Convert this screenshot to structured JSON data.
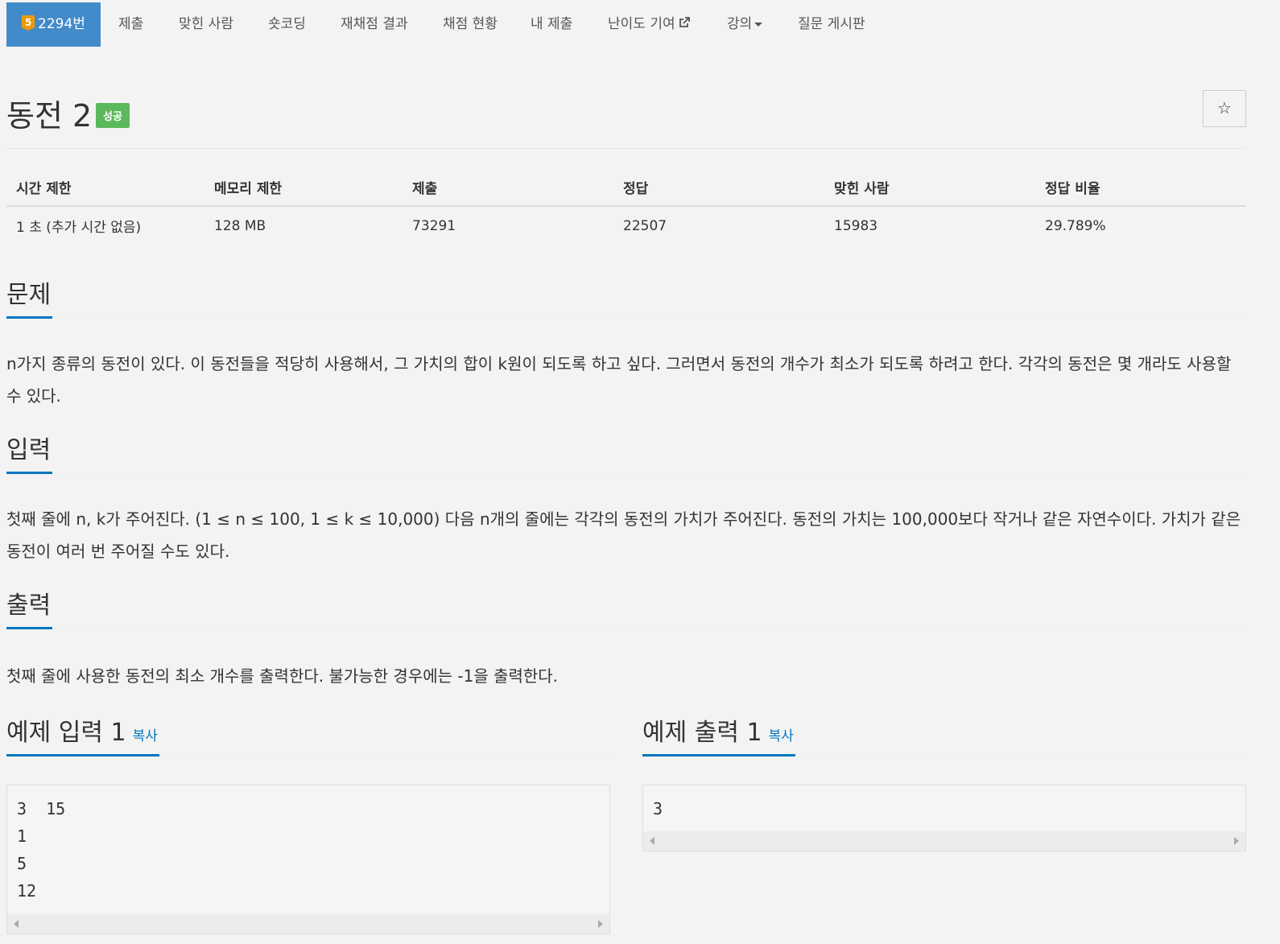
{
  "nav": {
    "problem_number": "2294번",
    "tier_level": "5",
    "items": [
      "제출",
      "맞힌 사람",
      "숏코딩",
      "재채점 결과",
      "채점 현황",
      "내 제출",
      "난이도 기여",
      "강의",
      "질문 게시판"
    ]
  },
  "problem": {
    "title": "동전 2",
    "status_badge": "성공",
    "star": "☆"
  },
  "info": {
    "headers": [
      "시간 제한",
      "메모리 제한",
      "제출",
      "정답",
      "맞힌 사람",
      "정답 비율"
    ],
    "values": [
      "1 초 (추가 시간 없음)",
      "128 MB",
      "73291",
      "22507",
      "15983",
      "29.789%"
    ]
  },
  "sections": {
    "problem_title": "문제",
    "problem_text": "n가지 종류의 동전이 있다. 이 동전들을 적당히 사용해서, 그 가치의 합이 k원이 되도록 하고 싶다. 그러면서 동전의 개수가 최소가 되도록 하려고 한다. 각각의 동전은 몇 개라도 사용할 수 있다.",
    "input_title": "입력",
    "input_text": "첫째 줄에 n, k가 주어진다. (1 ≤ n ≤ 100, 1 ≤ k ≤ 10,000) 다음 n개의 줄에는 각각의 동전의 가치가 주어진다. 동전의 가치는 100,000보다 작거나 같은 자연수이다. 가치가 같은 동전이 여러 번 주어질 수도 있다.",
    "output_title": "출력",
    "output_text": "첫째 줄에 사용한 동전의 최소 개수를 출력한다. 불가능한 경우에는 -1을 출력한다."
  },
  "samples": {
    "input_title": "예제 입력 1",
    "output_title": "예제 출력 1",
    "copy_label": "복사",
    "input_text": "3  15\n1\n5\n12",
    "output_text": "3"
  },
  "colors": {
    "nav_active": "#428bca",
    "tier_badge": "#ec9a00",
    "success_badge": "#5cb85c",
    "headline_underline": "#0076c0"
  }
}
